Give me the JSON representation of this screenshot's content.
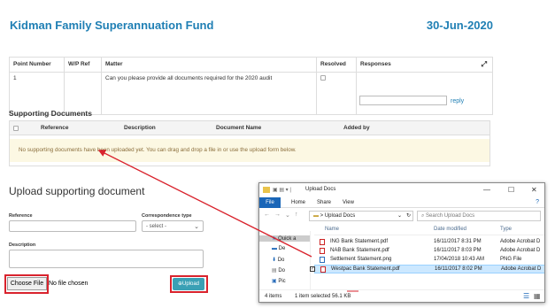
{
  "header": {
    "title": "Kidman Family Superannuation Fund",
    "date": "30-Jun-2020"
  },
  "matters": {
    "columns": [
      "Point Number",
      "W/P Ref",
      "Matter",
      "Resolved",
      "Responses"
    ],
    "row": {
      "point": "1",
      "wp_ref": "",
      "matter": "Can you please provide all documents required for the 2020 audit",
      "reply": "reply"
    }
  },
  "supporting": {
    "title": "Supporting Documents",
    "columns": [
      "Reference",
      "Description",
      "Document Name",
      "Added by"
    ],
    "empty_message": "No supporting documents have been uploaded yet. You can drag and drop a file in or use the upload form below."
  },
  "upload_form": {
    "title": "Upload supporting document",
    "reference_label": "Reference",
    "correspondence_label": "Correspondence type",
    "correspondence_value": "- select -",
    "description_label": "Description",
    "choose_file": "Choose File",
    "no_file": "No file chosen",
    "upload_button": "Upload"
  },
  "explorer": {
    "title": "Upload Docs",
    "ribbon": [
      "File",
      "Home",
      "Share",
      "View"
    ],
    "path": "Upload Docs",
    "search_placeholder": "Search Upload Docs",
    "nav_items": [
      "Quick a",
      "De",
      "Do",
      "Do",
      "Pic"
    ],
    "list_headers": [
      "Name",
      "Date modified",
      "Type"
    ],
    "files": [
      {
        "name": "ING Bank Statement.pdf",
        "date": "16/11/2017 8:31 PM",
        "type": "Adobe Acrobat D"
      },
      {
        "name": "NAB Bank Statement.pdf",
        "date": "16/11/2017 8:03 PM",
        "type": "Adobe Acrobat D"
      },
      {
        "name": "Settlement Statement.png",
        "date": "17/04/2018 10:43 AM",
        "type": "PNG File"
      },
      {
        "name": "Westpac Bank Statement.pdf",
        "date": "16/11/2017 8:02 PM",
        "type": "Adobe Acrobat D"
      }
    ],
    "status_count": "4 items",
    "status_selected": "1 item selected  56.1 KB"
  },
  "colors": {
    "brand_blue": "#1f7fb4",
    "highlight_red": "#d9232d",
    "upload_teal": "#3aa0b5",
    "empty_bg": "#fcf8e3"
  }
}
